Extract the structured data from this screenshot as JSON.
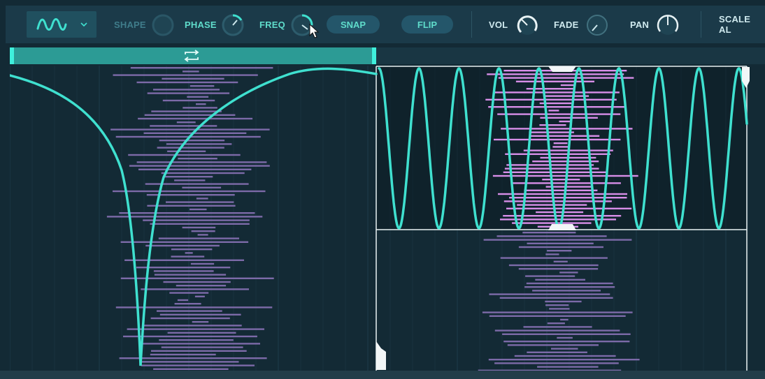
{
  "toolbar": {
    "shape_selector": {
      "icon": "sine-wave-icon",
      "dropdown_icon": "chevron-down-icon"
    },
    "shape_label": "SHAPE",
    "phase_label": "PHASE",
    "freq_label": "FREQ",
    "snap_label": "SNAP",
    "flip_label": "FLIP",
    "vol_label": "VOL",
    "fade_label": "FADE",
    "pan_label": "PAN",
    "scale_label": "SCALE AL"
  },
  "knobs": {
    "shape": 0.0,
    "phase": 0.3,
    "freq": 0.35,
    "vol": 0.75,
    "fade": 0.1,
    "pan": 0.5
  },
  "loop": {
    "icon": "loop-icon"
  },
  "colors": {
    "accent": "#3fe0cf",
    "background": "#132a35",
    "toolbar": "#1b3a49",
    "loop_bar": "#2c9b95",
    "notes_dim": "#7c6aa8",
    "notes_bright": "#d78ee8",
    "selection_border": "#e9f2f3"
  }
}
